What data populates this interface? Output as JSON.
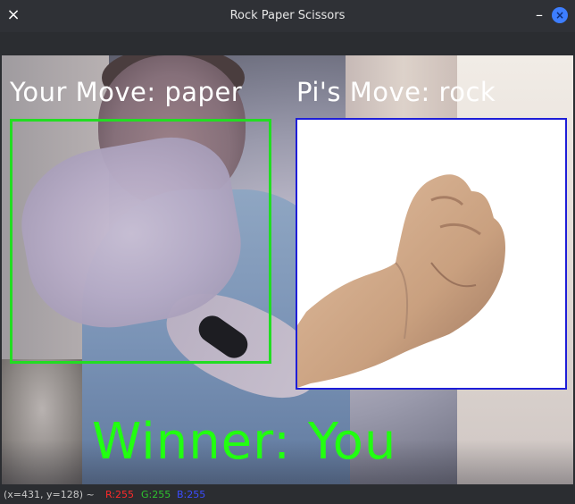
{
  "window": {
    "title": "Rock Paper Scissors",
    "close_icon": "×",
    "minimize_icon": "–",
    "close_right_icon": "×"
  },
  "game": {
    "your_move_label": "Your Move: paper",
    "pi_move_label": "Pi's Move: rock",
    "winner_label": "Winner: You"
  },
  "colors": {
    "your_box": "#22dd22",
    "pi_box": "#1e1ed8",
    "winner_text": "#22ff11"
  },
  "status": {
    "coords": "(x=431, y=128) ~",
    "r": "R:255",
    "g": "G:255",
    "b": "B:255"
  }
}
